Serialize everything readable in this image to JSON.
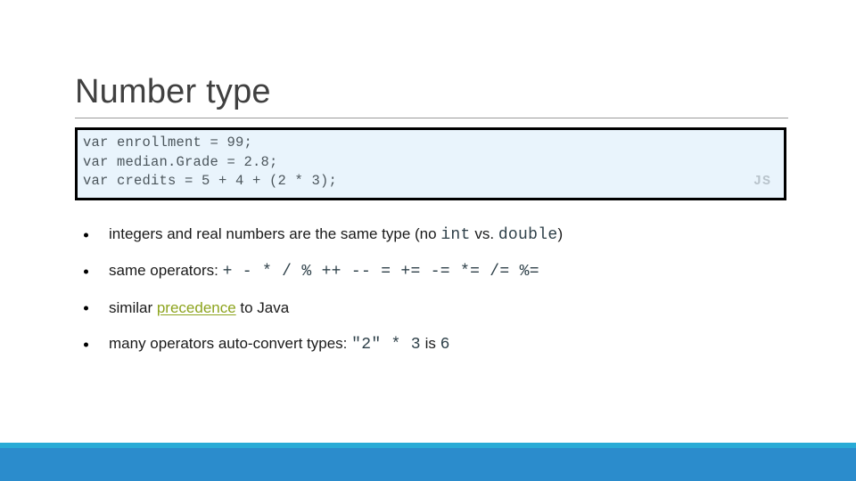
{
  "slide": {
    "title": "Number type",
    "code_block": {
      "language_label": "JS",
      "lines": "var enrollment = 99;\nvar median.Grade = 2.8;\nvar credits = 5 + 4 + (2 * 3);",
      "background_color": "#e9f4fc",
      "border_color": "#000000",
      "text_color": "#4c565c",
      "label_color": "#b9c4cc"
    },
    "bullets": [
      {
        "parts": [
          {
            "text": "integers and real numbers are the same type (no ",
            "style": "normal"
          },
          {
            "text": "int",
            "style": "mono"
          },
          {
            "text": " vs. ",
            "style": "normal"
          },
          {
            "text": "double",
            "style": "mono"
          },
          {
            "text": ")",
            "style": "normal"
          }
        ]
      },
      {
        "parts": [
          {
            "text": "same operators: ",
            "style": "normal"
          },
          {
            "text": "+  -  *  /  %  ++  --  =  +=  -=  *=  /=  %=",
            "style": "mono"
          }
        ]
      },
      {
        "parts": [
          {
            "text": "similar ",
            "style": "normal"
          },
          {
            "text": "precedence",
            "style": "link"
          },
          {
            "text": " to Java",
            "style": "normal"
          }
        ]
      },
      {
        "parts": [
          {
            "text": "many operators auto-convert types: ",
            "style": "normal"
          },
          {
            "text": "\"2\"  *  3",
            "style": "mono"
          },
          {
            "text": " is ",
            "style": "normal"
          },
          {
            "text": "6",
            "style": "mono"
          }
        ]
      }
    ],
    "footer": {
      "accent_color": "#29abd6",
      "bar_color": "#2b8ccc"
    }
  }
}
